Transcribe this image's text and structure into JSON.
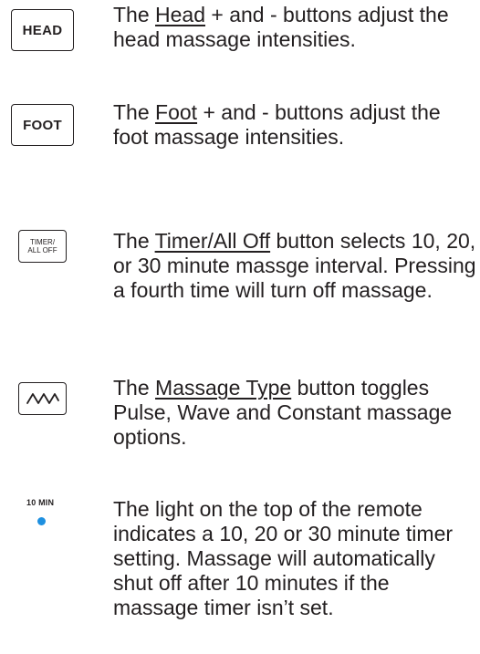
{
  "items": [
    {
      "button_label": "HEAD",
      "text_pre": "The ",
      "text_link": "Head",
      "text_post": " + and - buttons adjust the head massage intensities."
    },
    {
      "button_label": "FOOT",
      "text_pre": "The ",
      "text_link": "Foot",
      "text_post": " + and - buttons adjust the foot massage intensities."
    },
    {
      "button_label_line1": "TIMER/",
      "button_label_line2": "ALL OFF",
      "text_pre": "The ",
      "text_link": "Timer/All Off",
      "text_post": " button selects 10, 20, or 30 minute massge interval. Pressing a fourth time will turn off massage."
    },
    {
      "button_icon": "wave-icon",
      "text_pre": "The ",
      "text_link": "Massage Type",
      "text_post": " button toggles Pulse, Wave and Constant massage options."
    },
    {
      "indicator_label": "10 MIN",
      "indicator_color": "#1e90e0",
      "text": "The light on the top of the remote indicates a 10, 20 or 30 minute timer setting. Massage will automatically shut off after 10 minutes if the massage timer isn’t set."
    }
  ]
}
